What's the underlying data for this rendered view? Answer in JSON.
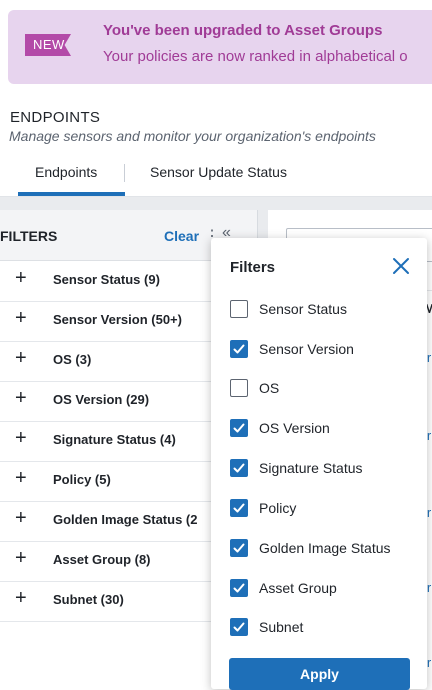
{
  "banner": {
    "tag": "NEW",
    "title": "You've been upgraded to Asset Groups",
    "text": "Your policies are now ranked in alphabetical o"
  },
  "header": {
    "title": "ENDPOINTS",
    "subtitle": "Manage sensors and monitor your organization's endpoints"
  },
  "tabs": [
    {
      "label": "Endpoints",
      "active": true
    },
    {
      "label": "Sensor Update Status",
      "active": false
    }
  ],
  "filters_panel": {
    "title": "FILTERS",
    "clear_label": "Clear",
    "kebab": "⋮",
    "collapse": "«",
    "items": [
      {
        "label": "Sensor Status (9)"
      },
      {
        "label": "Sensor Version (50+)"
      },
      {
        "label": "OS (3)"
      },
      {
        "label": "OS Version (29)"
      },
      {
        "label": "Signature Status (4)"
      },
      {
        "label": "Policy (5)"
      },
      {
        "label": "Golden Image Status (2"
      },
      {
        "label": "Asset Group (8)"
      },
      {
        "label": "Subnet (30)"
      }
    ],
    "expand_glyph": "+"
  },
  "popover": {
    "title": "Filters",
    "items": [
      {
        "label": "Sensor Status",
        "checked": false
      },
      {
        "label": "Sensor Version",
        "checked": true
      },
      {
        "label": "OS",
        "checked": false
      },
      {
        "label": "OS Version",
        "checked": true
      },
      {
        "label": "Signature Status",
        "checked": true
      },
      {
        "label": "Policy",
        "checked": true
      },
      {
        "label": "Golden Image Status",
        "checked": true
      },
      {
        "label": "Asset Group",
        "checked": true
      },
      {
        "label": "Subnet",
        "checked": true
      }
    ],
    "apply_label": "Apply"
  },
  "results_fragments": [
    "M",
    "ir",
    "ir",
    "ir",
    "ir",
    "ir"
  ],
  "colors": {
    "accent": "#1e6fb8",
    "banner_bg": "#e7d4ee",
    "banner_text": "#a03b96",
    "tag_bg": "#b34aa8"
  },
  "icons": {
    "close": "close-icon",
    "check": "check-icon",
    "plus": "plus-icon",
    "kebab": "kebab-menu-icon",
    "collapse": "collapse-left-icon"
  }
}
